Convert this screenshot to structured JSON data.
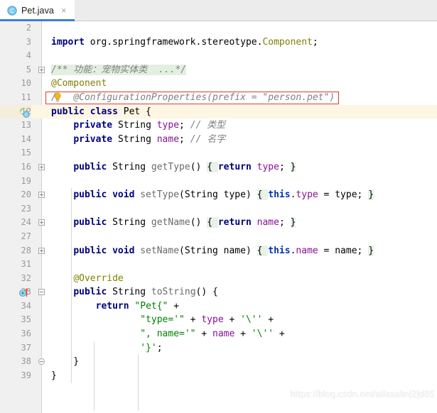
{
  "window": {
    "app": "IntelliJ IDEA Editor",
    "theme_colors": {
      "tab_active_underline": "#3c7fd0",
      "tabbar_bg": "#ececec",
      "gutter_bg": "#f0f0f0",
      "editor_bg": "#ffffff",
      "keyword": "#000080",
      "string": "#008000",
      "comment": "#808080",
      "annotation": "#808000",
      "field": "#871094",
      "method": "#6a6a6a",
      "this_keyword": "#0033b3",
      "brace_highlight": "#e8f2e8",
      "fold_highlight": "#e3efe1",
      "warning_border": "#d63b2f",
      "caret_line": "#fdf6e3"
    }
  },
  "tabs": [
    {
      "label": "Pet.java",
      "icon": "java-class-icon",
      "close_label": "×",
      "active": true
    }
  ],
  "editor": {
    "language": "java",
    "watermark": "https://blog.csdn.net/atlasalin|2|d85",
    "warning_line": 11,
    "caret_line": 12,
    "lines": [
      {
        "num": "2",
        "gutter_icon": null,
        "fold": null,
        "tokens": []
      },
      {
        "num": "3",
        "gutter_icon": null,
        "fold": null,
        "tokens": [
          {
            "t": "import ",
            "c": "kw"
          },
          {
            "t": "org.springframework.stereotype.",
            "c": "plain"
          },
          {
            "t": "Component",
            "c": "anno"
          },
          {
            "t": ";",
            "c": "plain"
          }
        ]
      },
      {
        "num": "4",
        "gutter_icon": null,
        "fold": null,
        "tokens": []
      },
      {
        "num": "5",
        "gutter_icon": null,
        "fold": "plus",
        "tokens": [
          {
            "t": "/** 功能：宠物实体类  ...*/",
            "c": "cmt-fold"
          }
        ]
      },
      {
        "num": "10",
        "gutter_icon": null,
        "fold": null,
        "tokens": [
          {
            "t": "@Component",
            "c": "anno"
          }
        ]
      },
      {
        "num": "11",
        "gutter_icon": null,
        "fold": null,
        "warn": true,
        "tokens": [
          {
            "t": "/",
            "c": "cmt"
          },
          {
            "t": "   ",
            "c": "cmt"
          },
          {
            "t": "@ConfigurationProperties(prefix = \"person.pet\")",
            "c": "cmt"
          }
        ]
      },
      {
        "num": "12",
        "gutter_icon": "spring-bean-icon",
        "fold": null,
        "caret": true,
        "tokens": [
          {
            "t": "public class ",
            "c": "kw"
          },
          {
            "t": "Pet",
            "c": "cls"
          },
          {
            "t": " {",
            "c": "plain"
          }
        ]
      },
      {
        "num": "13",
        "gutter_icon": null,
        "fold": null,
        "tokens": [
          {
            "t": "    ",
            "c": "plain"
          },
          {
            "t": "private ",
            "c": "kw"
          },
          {
            "t": "String ",
            "c": "plain"
          },
          {
            "t": "type",
            "c": "fld"
          },
          {
            "t": "; ",
            "c": "plain"
          },
          {
            "t": "// 类型",
            "c": "cmt"
          }
        ]
      },
      {
        "num": "14",
        "gutter_icon": null,
        "fold": null,
        "tokens": [
          {
            "t": "    ",
            "c": "plain"
          },
          {
            "t": "private ",
            "c": "kw"
          },
          {
            "t": "String ",
            "c": "plain"
          },
          {
            "t": "name",
            "c": "fld"
          },
          {
            "t": "; ",
            "c": "plain"
          },
          {
            "t": "// 名字",
            "c": "cmt"
          }
        ]
      },
      {
        "num": "15",
        "gutter_icon": null,
        "fold": null,
        "tokens": []
      },
      {
        "num": "16",
        "gutter_icon": null,
        "fold": "plus",
        "tokens": [
          {
            "t": "    ",
            "c": "plain"
          },
          {
            "t": "public ",
            "c": "kw"
          },
          {
            "t": "String ",
            "c": "plain"
          },
          {
            "t": "getType",
            "c": "mth"
          },
          {
            "t": "() ",
            "c": "plain"
          },
          {
            "t": "{ ",
            "c": "brace"
          },
          {
            "t": "return ",
            "c": "kw"
          },
          {
            "t": "type",
            "c": "fld"
          },
          {
            "t": "; ",
            "c": "plain"
          },
          {
            "t": "}",
            "c": "brace"
          }
        ]
      },
      {
        "num": "19",
        "gutter_icon": null,
        "fold": null,
        "tokens": []
      },
      {
        "num": "20",
        "gutter_icon": null,
        "fold": "plus",
        "tokens": [
          {
            "t": "    ",
            "c": "plain"
          },
          {
            "t": "public void ",
            "c": "kw"
          },
          {
            "t": "setType",
            "c": "mth"
          },
          {
            "t": "(String ",
            "c": "plain"
          },
          {
            "t": "type",
            "c": "plain"
          },
          {
            "t": ") ",
            "c": "plain"
          },
          {
            "t": "{ ",
            "c": "brace"
          },
          {
            "t": "this",
            "c": "this"
          },
          {
            "t": ".",
            "c": "plain"
          },
          {
            "t": "type",
            "c": "fld"
          },
          {
            "t": " = type; ",
            "c": "plain"
          },
          {
            "t": "}",
            "c": "brace"
          }
        ]
      },
      {
        "num": "23",
        "gutter_icon": null,
        "fold": null,
        "tokens": []
      },
      {
        "num": "24",
        "gutter_icon": null,
        "fold": "plus",
        "tokens": [
          {
            "t": "    ",
            "c": "plain"
          },
          {
            "t": "public ",
            "c": "kw"
          },
          {
            "t": "String ",
            "c": "plain"
          },
          {
            "t": "getName",
            "c": "mth"
          },
          {
            "t": "() ",
            "c": "plain"
          },
          {
            "t": "{ ",
            "c": "brace"
          },
          {
            "t": "return ",
            "c": "kw"
          },
          {
            "t": "name",
            "c": "fld"
          },
          {
            "t": "; ",
            "c": "plain"
          },
          {
            "t": "}",
            "c": "brace"
          }
        ]
      },
      {
        "num": "27",
        "gutter_icon": null,
        "fold": null,
        "tokens": []
      },
      {
        "num": "28",
        "gutter_icon": null,
        "fold": "plus",
        "tokens": [
          {
            "t": "    ",
            "c": "plain"
          },
          {
            "t": "public void ",
            "c": "kw"
          },
          {
            "t": "setName",
            "c": "mth"
          },
          {
            "t": "(String ",
            "c": "plain"
          },
          {
            "t": "name",
            "c": "plain"
          },
          {
            "t": ") ",
            "c": "plain"
          },
          {
            "t": "{ ",
            "c": "brace"
          },
          {
            "t": "this",
            "c": "this"
          },
          {
            "t": ".",
            "c": "plain"
          },
          {
            "t": "name",
            "c": "fld"
          },
          {
            "t": " = name; ",
            "c": "plain"
          },
          {
            "t": "}",
            "c": "brace"
          }
        ]
      },
      {
        "num": "31",
        "gutter_icon": null,
        "fold": null,
        "tokens": []
      },
      {
        "num": "32",
        "gutter_icon": null,
        "fold": null,
        "tokens": [
          {
            "t": "    ",
            "c": "plain"
          },
          {
            "t": "@Override",
            "c": "anno"
          }
        ]
      },
      {
        "num": "33",
        "gutter_icon": "override-icon",
        "fold": "minus",
        "tokens": [
          {
            "t": "    ",
            "c": "plain"
          },
          {
            "t": "public ",
            "c": "kw"
          },
          {
            "t": "String ",
            "c": "plain"
          },
          {
            "t": "toString",
            "c": "mth"
          },
          {
            "t": "() {",
            "c": "plain"
          }
        ]
      },
      {
        "num": "34",
        "gutter_icon": null,
        "fold": null,
        "tokens": [
          {
            "t": "        ",
            "c": "plain"
          },
          {
            "t": "return ",
            "c": "kw"
          },
          {
            "t": "\"Pet{\"",
            "c": "str"
          },
          {
            "t": " +",
            "c": "plain"
          }
        ]
      },
      {
        "num": "35",
        "gutter_icon": null,
        "fold": null,
        "tokens": [
          {
            "t": "                ",
            "c": "plain"
          },
          {
            "t": "\"type='\"",
            "c": "str"
          },
          {
            "t": " + ",
            "c": "plain"
          },
          {
            "t": "type",
            "c": "fld"
          },
          {
            "t": " + ",
            "c": "plain"
          },
          {
            "t": "'\\''",
            "c": "str"
          },
          {
            "t": " +",
            "c": "plain"
          }
        ]
      },
      {
        "num": "36",
        "gutter_icon": null,
        "fold": null,
        "tokens": [
          {
            "t": "                ",
            "c": "plain"
          },
          {
            "t": "\", name='\"",
            "c": "str"
          },
          {
            "t": " + ",
            "c": "plain"
          },
          {
            "t": "name",
            "c": "fld"
          },
          {
            "t": " + ",
            "c": "plain"
          },
          {
            "t": "'\\''",
            "c": "str"
          },
          {
            "t": " +",
            "c": "plain"
          }
        ]
      },
      {
        "num": "37",
        "gutter_icon": null,
        "fold": null,
        "tokens": [
          {
            "t": "                ",
            "c": "plain"
          },
          {
            "t": "'}'",
            "c": "str"
          },
          {
            "t": ";",
            "c": "plain"
          }
        ]
      },
      {
        "num": "38",
        "gutter_icon": null,
        "fold": "minus-round",
        "tokens": [
          {
            "t": "    }",
            "c": "plain"
          }
        ]
      },
      {
        "num": "39",
        "gutter_icon": null,
        "fold": null,
        "tokens": [
          {
            "t": "}",
            "c": "plain"
          }
        ]
      }
    ]
  }
}
